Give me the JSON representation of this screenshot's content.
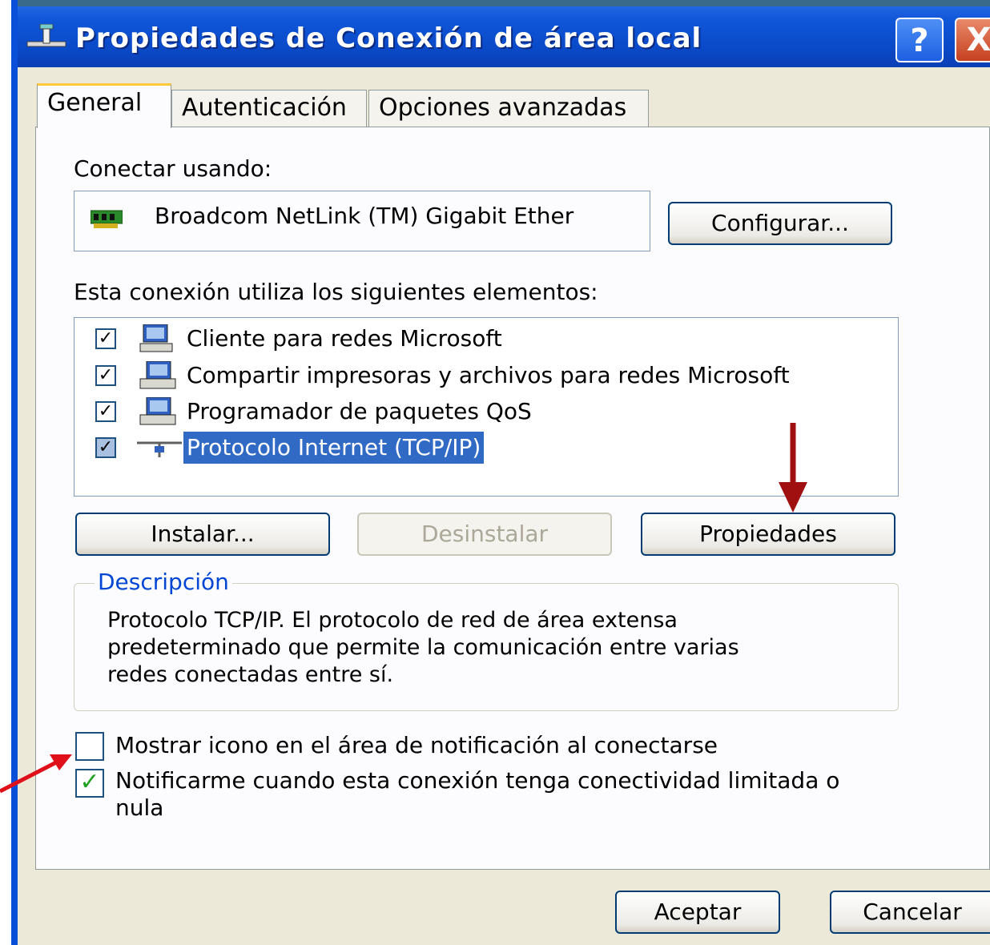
{
  "window": {
    "title": "Propiedades de Conexión de área local",
    "help_label": "?",
    "close_label": "X"
  },
  "tabs": [
    {
      "label": "General",
      "active": true
    },
    {
      "label": "Autenticación",
      "active": false
    },
    {
      "label": "Opciones avanzadas",
      "active": false
    }
  ],
  "connect_using": {
    "label": "Conectar usando:",
    "adapter_name": "Broadcom NetLink (TM) Gigabit Ether",
    "configure_label": "Configurar..."
  },
  "components": {
    "label": "Esta conexión utiliza los siguientes elementos:",
    "items": [
      {
        "label": "Cliente para redes Microsoft",
        "checked": true,
        "icon": "network-client-icon",
        "selected": false
      },
      {
        "label": "Compartir impresoras y archivos para redes Microsoft",
        "checked": true,
        "icon": "file-printer-sharing-icon",
        "selected": false
      },
      {
        "label": "Programador de paquetes QoS",
        "checked": true,
        "icon": "qos-scheduler-icon",
        "selected": false
      },
      {
        "label": "Protocolo Internet (TCP/IP)",
        "checked": true,
        "icon": "protocol-icon",
        "selected": true
      }
    ]
  },
  "actions": {
    "install_label": "Instalar...",
    "uninstall_label": "Desinstalar",
    "properties_label": "Propiedades"
  },
  "description": {
    "title": "Descripción",
    "text_lines": [
      "Protocolo TCP/IP. El protocolo de red de área extensa",
      "predeterminado que permite la comunicación entre varias",
      "redes conectadas entre sí."
    ]
  },
  "options": {
    "show_icon": {
      "label": "Mostrar icono en el área de notificación al conectarse",
      "checked": false
    },
    "notify_limited": {
      "label_lines": [
        "Notificarme cuando esta conexión tenga conectividad limitada o",
        "nula"
      ],
      "checked": true
    }
  },
  "footer": {
    "ok_label": "Aceptar",
    "cancel_label": "Cancelar"
  },
  "colors": {
    "titlebar": "#0a4ac9",
    "selection": "#316ac5",
    "group_title": "#0046d5",
    "annotation_arrow_red": "#e0101a",
    "annotation_arrow_dark_red": "#a01010"
  }
}
